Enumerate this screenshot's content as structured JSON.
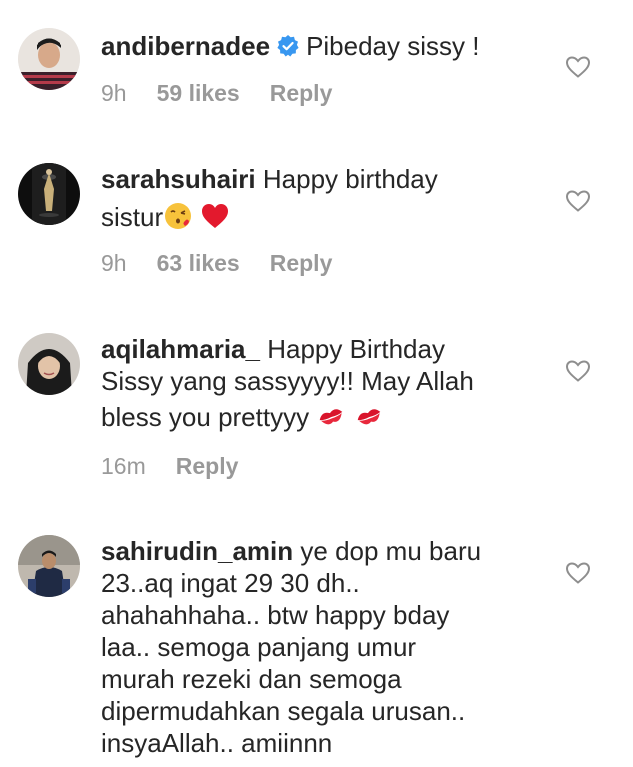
{
  "comments": [
    {
      "username": "andibernadee",
      "verified": true,
      "text": "Pibeday sissy !",
      "time": "9h",
      "likes": "59 likes",
      "reply": "Reply"
    },
    {
      "username": "sarahsuhairi",
      "verified": false,
      "text_line1": "Happy birthday",
      "text_line2": "sistur",
      "emojis": [
        "kissing-face-emoji",
        "red-heart-emoji"
      ],
      "time": "9h",
      "likes": "63 likes",
      "reply": "Reply"
    },
    {
      "username": "aqilahmaria_",
      "verified": false,
      "text_line1": "Happy Birthday",
      "text_line2": "Sissy yang sassyyyy!! May Allah",
      "text_line3": "bless you prettyyy",
      "emojis": [
        "kiss-mark-emoji",
        "kiss-mark-emoji"
      ],
      "time": "16m",
      "reply": "Reply"
    },
    {
      "username": "sahirudin_amin",
      "verified": false,
      "text_line1": "ye dop mu baru",
      "text_line2": "23..aq ingat 29 30 dh..",
      "text_line3": "ahahahhaha.. btw happy bday",
      "text_line4": "laa.. semoga panjang umur",
      "text_line5": "murah rezeki dan semoga",
      "text_line6": "dipermudahkan segala urusan..",
      "text_line7": "insyaAllah.. amiinnn"
    }
  ],
  "colors": {
    "text": "#262626",
    "meta": "#999999",
    "verified": "#3897f0",
    "heart_outline": "#8e8e8e"
  },
  "icons": [
    "verified-badge-icon",
    "heart-like-icon"
  ]
}
